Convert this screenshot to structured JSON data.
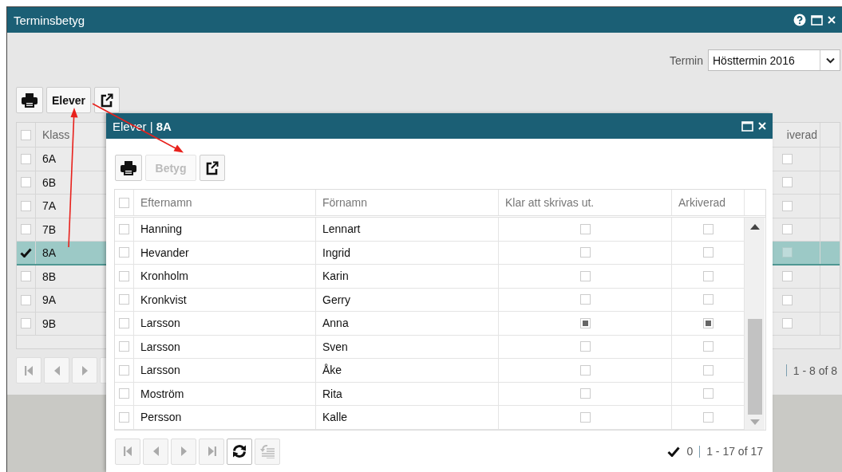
{
  "window": {
    "title": "Terminsbetyg"
  },
  "term": {
    "label": "Termin",
    "value": "Hösttermin 2016"
  },
  "toolbar": {
    "label": "Elever",
    "disabled": false
  },
  "table": {
    "header_checked": false,
    "columns": [
      "Klass",
      "iverad"
    ],
    "rows": [
      {
        "klass": "6A",
        "checked": false,
        "selected": false,
        "archived": false
      },
      {
        "klass": "6B",
        "checked": false,
        "selected": false,
        "archived": false
      },
      {
        "klass": "7A",
        "checked": false,
        "selected": false,
        "archived": false
      },
      {
        "klass": "7B",
        "checked": false,
        "selected": false,
        "archived": false
      },
      {
        "klass": "8A",
        "checked": true,
        "selected": true,
        "archived": false
      },
      {
        "klass": "8B",
        "checked": false,
        "selected": false,
        "archived": false
      },
      {
        "klass": "9A",
        "checked": false,
        "selected": false,
        "archived": false
      },
      {
        "klass": "9B",
        "checked": false,
        "selected": false,
        "archived": false
      }
    ]
  },
  "pager": {
    "summary": "1 - 8 of 8"
  },
  "dialog": {
    "title": "Elever | **8A**",
    "toolbar": {
      "label": "Betyg",
      "disabled": true
    },
    "header_checked": false,
    "columns": [
      "Efternamn",
      "Förnamn",
      "Klar att skrivas ut.",
      "Arkiverad"
    ],
    "rows": [
      {
        "efternamn": "Hanning",
        "fornamn": "Lennart",
        "selected": false,
        "ready": false,
        "archived": false
      },
      {
        "efternamn": "Hevander",
        "fornamn": "Ingrid",
        "selected": false,
        "ready": false,
        "archived": false
      },
      {
        "efternamn": "Kronholm",
        "fornamn": "Karin",
        "selected": false,
        "ready": false,
        "archived": false
      },
      {
        "efternamn": "Kronkvist",
        "fornamn": "Gerry",
        "selected": false,
        "ready": false,
        "archived": false
      },
      {
        "efternamn": "Larsson",
        "fornamn": "Anna",
        "selected": false,
        "ready": true,
        "archived": true
      },
      {
        "efternamn": "Larsson",
        "fornamn": "Sven",
        "selected": false,
        "ready": false,
        "archived": false
      },
      {
        "efternamn": "Larsson",
        "fornamn": "Åke",
        "selected": false,
        "ready": false,
        "archived": false
      },
      {
        "efternamn": "Moström",
        "fornamn": "Rita",
        "selected": false,
        "ready": false,
        "archived": false
      },
      {
        "efternamn": "Persson",
        "fornamn": "Kalle",
        "selected": false,
        "ready": false,
        "archived": false
      }
    ],
    "pager": {
      "checked_count": "0",
      "summary": "1 - 17 of 17"
    }
  }
}
